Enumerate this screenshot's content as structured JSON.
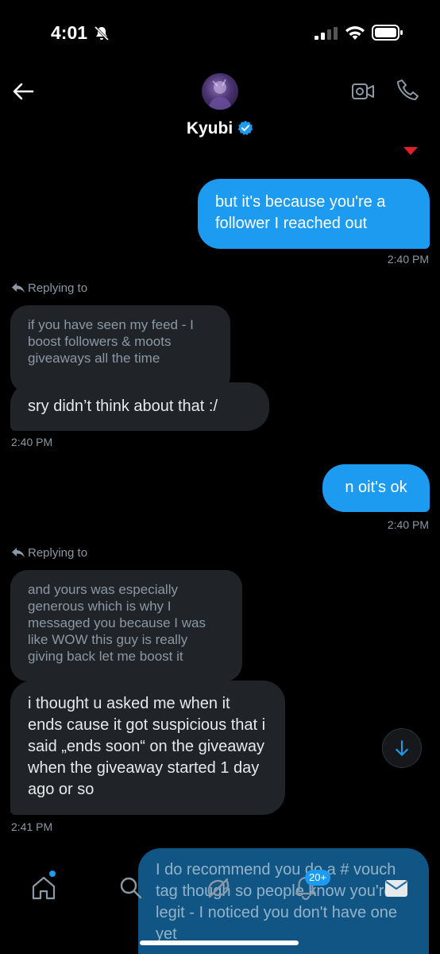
{
  "status_bar": {
    "time": "4:01"
  },
  "header": {
    "contact_name": "Kyubi"
  },
  "messages": {
    "m1": {
      "text": "but it's because you're a follower I reached out",
      "time": "2:40 PM"
    },
    "m2": {
      "reply_label": "Replying to",
      "quoted": "if you have seen my feed - I boost followers & moots giveaways all the time",
      "text": "sry didn’t think about that :/",
      "time": "2:40 PM"
    },
    "m3": {
      "text": "n oit's ok",
      "time": "2:40 PM"
    },
    "m4": {
      "reply_label": "Replying to",
      "quoted": "and yours was especially generous which is why I messaged you because I was like WOW this guy is really giving back let me boost it",
      "text": "i thought u asked me when it ends cause it got suspicious that i said „ends soon“ on the giveaway when the giveaway started 1 day ago or so",
      "time": "2:41 PM"
    },
    "m5": {
      "text": "I do recommend you do a # vouch tag though so people know you're legit - I noticed you don't have one yet"
    }
  },
  "bottom_nav": {
    "notifications_badge": "20+"
  },
  "colors": {
    "accent": "#1d9bf0",
    "incoming_bubble": "#202327",
    "background": "#000000"
  },
  "icons": [
    "bell-slash-icon",
    "signal-icon",
    "wifi-icon",
    "battery-icon",
    "back-arrow-icon",
    "verified-badge-icon",
    "video-call-icon",
    "phone-call-icon",
    "reply-arrow-icon",
    "arrow-down-icon",
    "home-icon",
    "search-icon",
    "grok-icon",
    "notifications-icon",
    "messages-icon"
  ]
}
